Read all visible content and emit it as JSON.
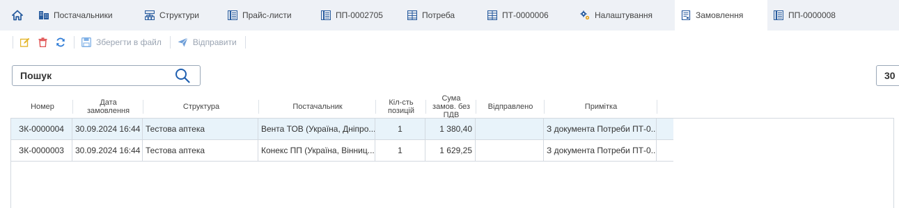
{
  "tabs": [
    {
      "label": "Постачальники",
      "icon": "building-grid-icon"
    },
    {
      "label": "Структури",
      "icon": "org-structure-icon"
    },
    {
      "label": "Прайс-листи",
      "icon": "price-list-icon"
    },
    {
      "label": "ПП-0002705",
      "icon": "price-list-icon"
    },
    {
      "label": "Потреба",
      "icon": "table-grid-icon"
    },
    {
      "label": "ПТ-0000006",
      "icon": "table-grid-icon"
    },
    {
      "label": "Налаштування",
      "icon": "gears-icon"
    },
    {
      "label": "Замовлення",
      "icon": "order-document-icon"
    },
    {
      "label": "ПП-0000008",
      "icon": "price-list-icon"
    }
  ],
  "active_tab": "Замовлення",
  "toolbar": {
    "save_label": "Зберегти в файл",
    "send_label": "Відправити"
  },
  "search": {
    "placeholder": "Пошук"
  },
  "right_box_text": "30",
  "grid": {
    "columns": [
      "Номер",
      "Дата замовлення",
      "Структура",
      "Постачальник",
      "Кіл-сть позицій",
      "Сума замов. без ПДВ",
      "Відправлено",
      "Примітка"
    ],
    "rows": [
      {
        "number": "ЗК-0000004",
        "date": "30.09.2024 16:44",
        "structure": "Тестова аптека",
        "supplier": "Вента ТОВ (Україна, Дніпро...",
        "count": "1",
        "sum": "1 380,40",
        "sent": "",
        "note": "З документа Потреби ПТ-0..."
      },
      {
        "number": "ЗК-0000003",
        "date": "30.09.2024 16:44",
        "structure": "Тестова аптека",
        "supplier": "Конекс ПП (Україна, Вінниц...",
        "count": "1",
        "sum": "1 629,25",
        "sent": "",
        "note": "З документа Потреби ПТ-0..."
      }
    ]
  },
  "colors": {
    "tabbar_bg": "#eef1f6",
    "selected_row_bg": "#e8f3fa",
    "icon_blue": "#2a5d9f",
    "edit_yellow": "#e3b52a",
    "delete_red": "#e05151",
    "refresh_blue": "#2e7bd6"
  }
}
